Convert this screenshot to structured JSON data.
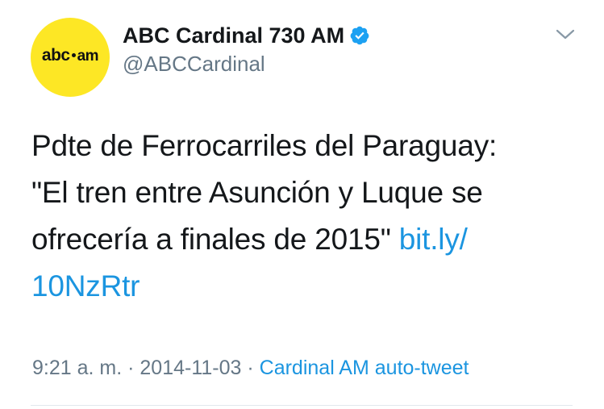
{
  "account": {
    "avatar_logo_main": "abc",
    "avatar_logo_suffix": "am",
    "display_name": "ABC Cardinal 730 AM",
    "handle": "@ABCCardinal",
    "verified": true,
    "avatar_color": "#fde725"
  },
  "tweet": {
    "text_line1": "Pdte de Ferrocarriles del Paraguay:",
    "text_line2": "\"El tren entre Asunción y Luque se",
    "text_line3_prefix": "ofrecería a finales de 2015\" ",
    "link_part1": "bit.ly/",
    "link_part2": "10NzRtr"
  },
  "meta": {
    "time": "9:21 a. m.",
    "separator1": " · ",
    "date": "2014-11-03",
    "separator2": " · ",
    "source": "Cardinal AM auto-tweet"
  },
  "colors": {
    "link": "#1b95e0",
    "secondary_text": "#657786",
    "primary_text": "#14171a",
    "verified": "#1da1f2"
  },
  "icons": {
    "verified": "verified-badge-icon",
    "menu": "chevron-down-icon"
  }
}
